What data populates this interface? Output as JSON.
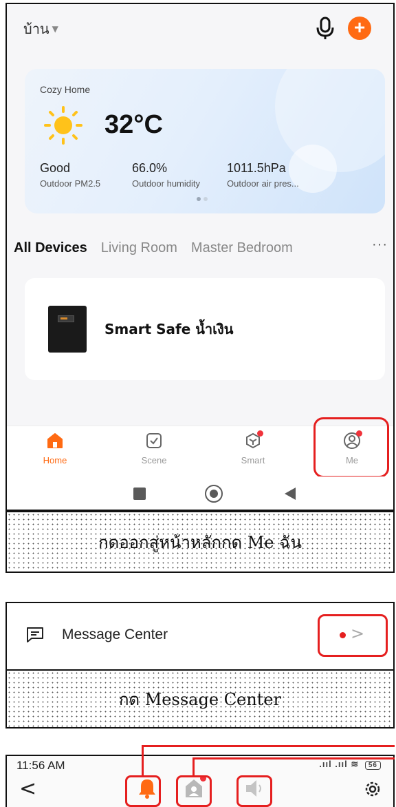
{
  "home_screen": {
    "home_selector": "บ้าน",
    "weather": {
      "place": "Cozy Home",
      "temperature": "32°C",
      "stats": [
        {
          "value": "Good",
          "label": "Outdoor PM2.5"
        },
        {
          "value": "66.0%",
          "label": "Outdoor humidity"
        },
        {
          "value": "1011.5hPa",
          "label": "Outdoor air pres..."
        }
      ]
    },
    "tabs": [
      "All Devices",
      "Living Room",
      "Master Bedroom"
    ],
    "tab_more": "···",
    "device": {
      "name": "Smart Safe น้ำเงิน"
    },
    "nav": {
      "home": "Home",
      "scene": "Scene",
      "smart": "Smart",
      "me": "Me"
    },
    "colors": {
      "accent": "#ff6a13",
      "highlight": "#e51f1f"
    }
  },
  "caption1": "กดออกสู่หน้าหลักกด Me ฉัน",
  "message_row": {
    "label": "Message Center",
    "chevron": ">"
  },
  "caption2": "กด Message Center",
  "message_header": {
    "time": "11:56 AM",
    "battery": "56",
    "back": "<"
  }
}
